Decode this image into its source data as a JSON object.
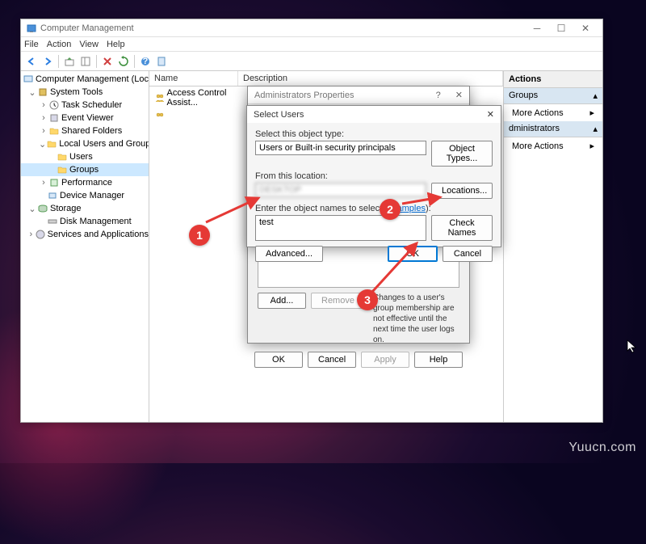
{
  "window": {
    "title": "Computer Management",
    "menu": [
      "File",
      "Action",
      "View",
      "Help"
    ]
  },
  "tree": {
    "root": "Computer Management (Local",
    "system_tools": "System Tools",
    "task_scheduler": "Task Scheduler",
    "event_viewer": "Event Viewer",
    "shared_folders": "Shared Folders",
    "local_users": "Local Users and Groups",
    "users": "Users",
    "groups": "Groups",
    "performance": "Performance",
    "device_manager": "Device Manager",
    "storage": "Storage",
    "disk_management": "Disk Management",
    "services": "Services and Applications"
  },
  "list": {
    "columns": {
      "name": "Name",
      "description": "Description"
    },
    "row1": {
      "name": "Access Control Assist..."
    }
  },
  "actions": {
    "header": "Actions",
    "group1": "Groups",
    "group2": "dministrators",
    "more": "More Actions"
  },
  "prop_dialog": {
    "title": "Administrators Properties",
    "help": "?",
    "note": "Changes to a user's group membership are not effective until the next time the user logs on.",
    "add": "Add...",
    "remove": "Remove",
    "ok": "OK",
    "cancel": "Cancel",
    "apply": "Apply",
    "help_btn": "Help"
  },
  "select_dialog": {
    "title": "Select Users",
    "object_type_label": "Select this object type:",
    "object_type_value": "Users or Built-in security principals",
    "object_types_btn": "Object Types...",
    "location_label": "From this location:",
    "location_value": "DESKTOP",
    "locations_btn": "Locations...",
    "names_label_prefix": "Enter the object names to select (",
    "names_label_link": "examples",
    "names_label_suffix": "):",
    "names_value": "test",
    "check_names": "Check Names",
    "advanced": "Advanced...",
    "ok": "OK",
    "cancel": "Cancel"
  },
  "annotations": {
    "n1": "1",
    "n2": "2",
    "n3": "3"
  },
  "watermark": "Yuucn.com"
}
